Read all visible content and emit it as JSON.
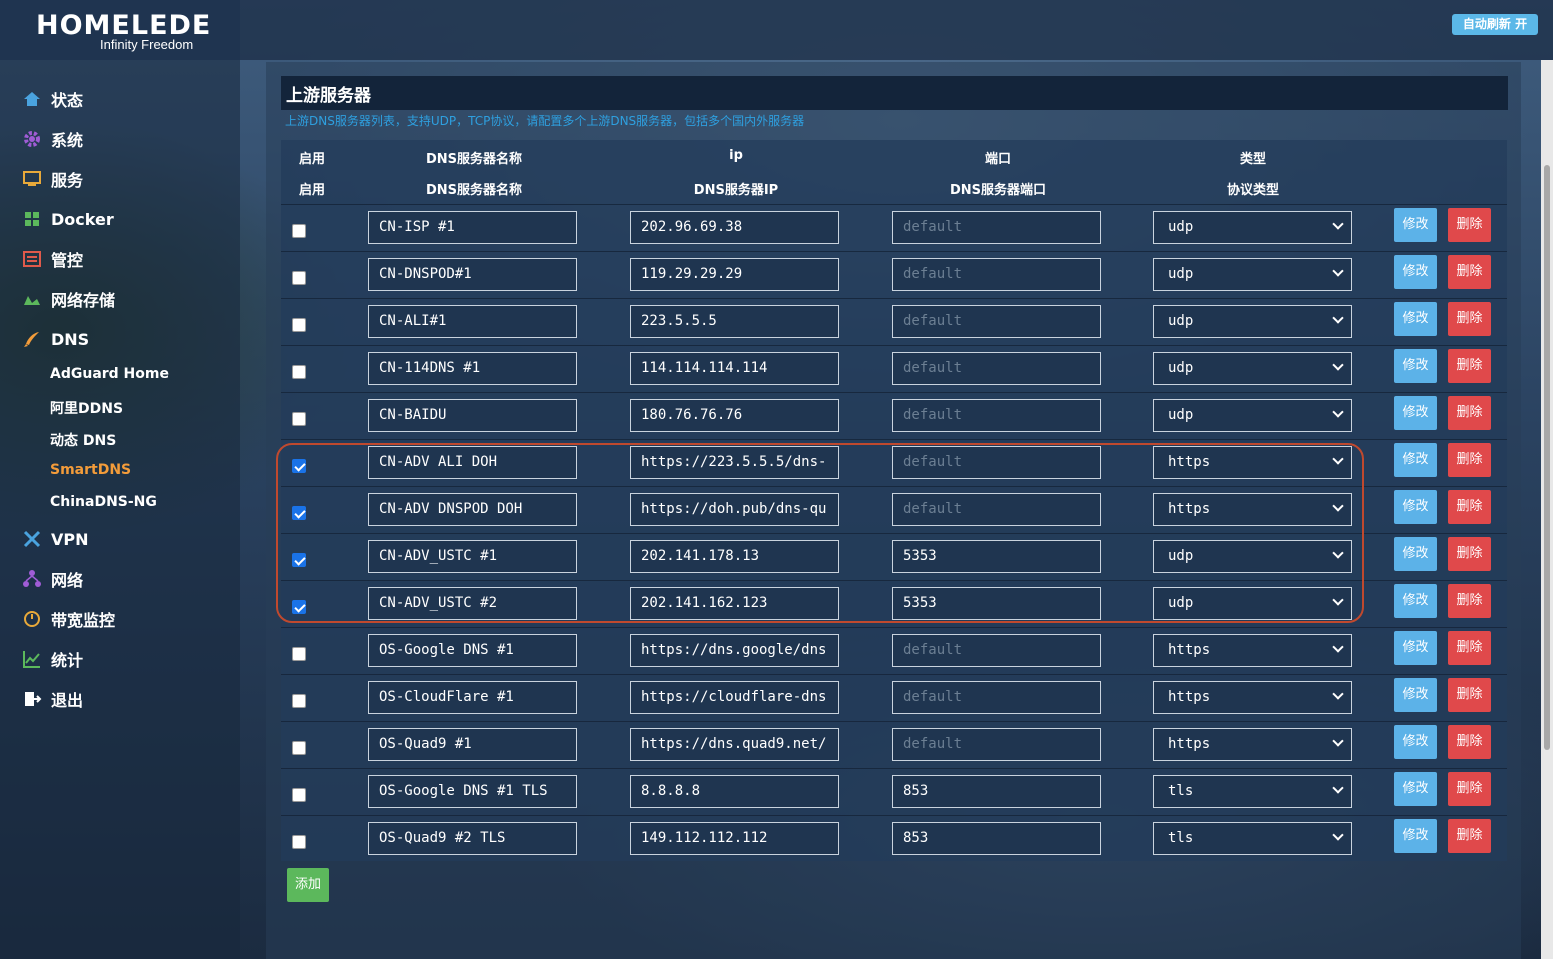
{
  "app": {
    "logo_main": "HOMELEDE",
    "logo_sub": "Infinity Freedom",
    "refresh_label": "自动刷新 开"
  },
  "sidebar": {
    "items": [
      {
        "label": "状态",
        "icon": "home-icon",
        "color": "#4aa3df"
      },
      {
        "label": "系统",
        "icon": "gear-icon",
        "color": "#a05cd6"
      },
      {
        "label": "服务",
        "icon": "service-icon",
        "color": "#e8a93a"
      },
      {
        "label": "Docker",
        "icon": "docker-icon",
        "color": "#5cb85c"
      },
      {
        "label": "管控",
        "icon": "control-icon",
        "color": "#e05a4b"
      },
      {
        "label": "网络存储",
        "icon": "storage-icon",
        "color": "#5cb85c"
      },
      {
        "label": "DNS",
        "icon": "rocket-icon",
        "color": "#f39c3a"
      }
    ],
    "dns_sub": [
      {
        "label": "AdGuard Home"
      },
      {
        "label": "阿里DDNS"
      },
      {
        "label": "动态 DNS"
      },
      {
        "label": "SmartDNS",
        "active": true
      },
      {
        "label": "ChinaDNS-NG"
      }
    ],
    "items_after": [
      {
        "label": "VPN",
        "icon": "vpn-icon",
        "color": "#4aa3df"
      },
      {
        "label": "网络",
        "icon": "network-icon",
        "color": "#a05cd6"
      },
      {
        "label": "带宽监控",
        "icon": "bandwidth-icon",
        "color": "#e8a93a"
      },
      {
        "label": "统计",
        "icon": "stats-icon",
        "color": "#5cb85c"
      },
      {
        "label": "退出",
        "icon": "logout-icon",
        "color": "#ffffff"
      }
    ]
  },
  "main": {
    "title": "上游服务器",
    "description": "上游DNS服务器列表，支持UDP，TCP协议，请配置多个上游DNS服务器，包括多个国内外服务器",
    "header1": [
      "启用",
      "DNS服务器名称",
      "ip",
      "端口",
      "类型"
    ],
    "header2": [
      "启用",
      "DNS服务器名称",
      "DNS服务器IP",
      "DNS服务器端口",
      "协议类型"
    ],
    "port_placeholder": "default",
    "edit_label": "修改",
    "delete_label": "删除",
    "add_label": "添加",
    "rows": [
      {
        "enabled": false,
        "name": "CN-ISP #1",
        "ip": "202.96.69.38",
        "port": "",
        "type": "udp"
      },
      {
        "enabled": false,
        "name": "CN-DNSPOD#1",
        "ip": "119.29.29.29",
        "port": "",
        "type": "udp"
      },
      {
        "enabled": false,
        "name": "CN-ALI#1",
        "ip": "223.5.5.5",
        "port": "",
        "type": "udp"
      },
      {
        "enabled": false,
        "name": "CN-114DNS #1",
        "ip": "114.114.114.114",
        "port": "",
        "type": "udp"
      },
      {
        "enabled": false,
        "name": "CN-BAIDU",
        "ip": "180.76.76.76",
        "port": "",
        "type": "udp"
      },
      {
        "enabled": true,
        "name": "CN-ADV ALI DOH",
        "ip": "https://223.5.5.5/dns-",
        "port": "",
        "type": "https"
      },
      {
        "enabled": true,
        "name": "CN-ADV DNSPOD DOH",
        "ip": "https://doh.pub/dns-qu",
        "port": "",
        "type": "https"
      },
      {
        "enabled": true,
        "name": "CN-ADV_USTC #1",
        "ip": "202.141.178.13",
        "port": "5353",
        "type": "udp"
      },
      {
        "enabled": true,
        "name": "CN-ADV_USTC #2",
        "ip": "202.141.162.123",
        "port": "5353",
        "type": "udp"
      },
      {
        "enabled": false,
        "name": "OS-Google DNS #1",
        "ip": "https://dns.google/dns",
        "port": "",
        "type": "https"
      },
      {
        "enabled": false,
        "name": "OS-CloudFlare #1",
        "ip": "https://cloudflare-dns",
        "port": "",
        "type": "https"
      },
      {
        "enabled": false,
        "name": "OS-Quad9 #1",
        "ip": "https://dns.quad9.net/",
        "port": "",
        "type": "https"
      },
      {
        "enabled": false,
        "name": "OS-Google DNS #1 TLS",
        "ip": "8.8.8.8",
        "port": "853",
        "type": "tls"
      },
      {
        "enabled": false,
        "name": "OS-Quad9 #2 TLS",
        "ip": "149.112.112.112",
        "port": "853",
        "type": "tls"
      }
    ]
  },
  "colors": {
    "accent": "#2ea0e0",
    "active_nav": "#f39c3a",
    "edit_button": "#5cb2e8",
    "delete_button": "#e0494b",
    "add_button": "#5cb85c",
    "highlight_border": "#c0492e"
  }
}
